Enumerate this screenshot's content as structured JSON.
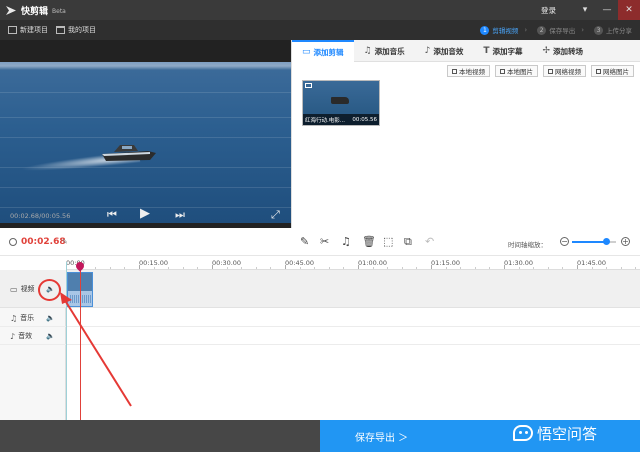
{
  "titlebar": {
    "app_name": "快剪辑",
    "app_tag": "Beta",
    "login": "登录",
    "menu_icon": "chevron-down-icon",
    "min_label": "—",
    "close_label": "✕"
  },
  "toolbar": {
    "new_project": "新建项目",
    "my_projects": "我的项目"
  },
  "steps": [
    {
      "num": "1",
      "label": "剪辑视频"
    },
    {
      "num": "2",
      "label": "保存导出"
    },
    {
      "num": "3",
      "label": "上传分享"
    }
  ],
  "preview": {
    "time": "00:02.68/00:05.56"
  },
  "right_panel": {
    "tabs": [
      {
        "label": "添加剪辑"
      },
      {
        "label": "添加音乐"
      },
      {
        "label": "添加音效"
      },
      {
        "label": "添加字幕"
      },
      {
        "label": "添加转场"
      }
    ],
    "buttons": [
      "本地视频",
      "本地图片",
      "网络视频",
      "网络图片"
    ],
    "clip": {
      "name": "红海行动.电影...",
      "duration": "00:05.56"
    }
  },
  "timeline": {
    "current_time": "00:02.68",
    "zoom_label": "时间轴缩放：",
    "zoom_level": 0.78,
    "ticks": [
      "00:00",
      "00:15.00",
      "00:30.00",
      "00:45.00",
      "01:00.00",
      "01:15.00",
      "01:30.00",
      "01:45.00"
    ],
    "tracks": [
      {
        "label": "视频"
      },
      {
        "label": "音乐"
      },
      {
        "label": "音效"
      }
    ]
  },
  "footer": {
    "export_label": "保存导出 ＞",
    "watermark": "悟空问答"
  },
  "colors": {
    "accent": "#1e88ff",
    "time_red": "#e0413a",
    "annotation_red": "#e53935",
    "export_blue": "#2196f3"
  }
}
